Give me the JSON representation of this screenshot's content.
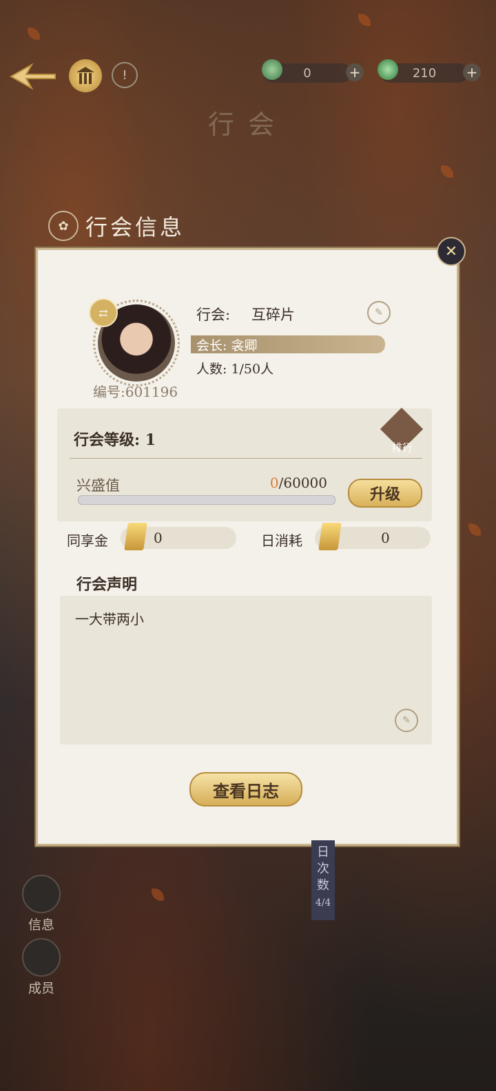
{
  "topbar": {
    "currency_a": {
      "value": "0",
      "icon": "jade-swirl-icon"
    },
    "currency_b": {
      "value": "210",
      "icon": "jade-gourd-icon"
    },
    "plus_label": "+"
  },
  "page_title": "行会",
  "section_title": "行会信息",
  "guild": {
    "name_label": "行会:",
    "name": "互碎片",
    "leader": "会长: 衾卿",
    "members": "人数: 1/50人",
    "id": "编号:601196",
    "level_label": "行会等级: 1",
    "rank_label": "排行",
    "prosperity_label": "兴盛值",
    "prosperity_current": "0",
    "prosperity_max": "/60000",
    "prosperity_fraction": 0,
    "upgrade_label": "升级",
    "shared_fund_label": "同享金",
    "shared_fund_value": "0",
    "daily_cost_label": "日消耗",
    "daily_cost_value": "0",
    "declaration_label": "行会声明",
    "declaration_text": "一大带两小",
    "view_log_label": "查看日志"
  },
  "sidebar": {
    "info_label": "信息",
    "members_label": "成员"
  },
  "daily_badge": {
    "label": "日次数",
    "count": "4/4"
  },
  "colors": {
    "accent": "#d87a3a",
    "gold": "#d6ae58",
    "card": "#f4f1ea"
  }
}
